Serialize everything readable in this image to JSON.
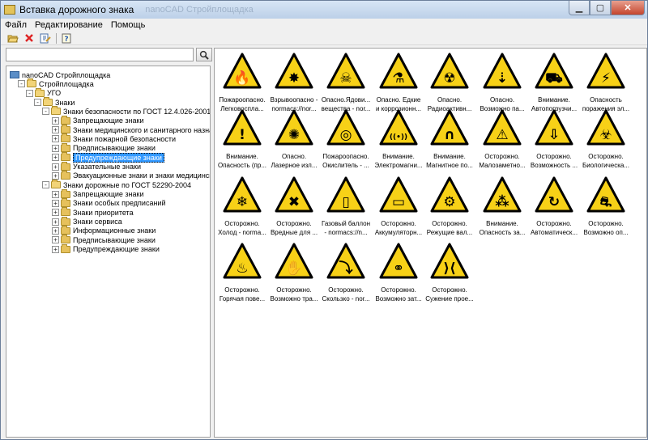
{
  "window": {
    "title": "Вставка дорожного знака",
    "title_ghost": "nanoCAD Стройплощадка",
    "min_icon": "minimize-icon",
    "max_icon": "maximize-icon",
    "close_icon": "close-icon"
  },
  "menu": [
    "Файл",
    "Редактирование",
    "Помощь"
  ],
  "toolbar": {
    "icons": [
      "open-folder-icon",
      "delete-icon",
      "edit-icon",
      "help-icon"
    ]
  },
  "search": {
    "value": "",
    "placeholder": "",
    "icon": "magnifier-icon"
  },
  "tree": [
    {
      "label": "nanoCAD Стройплощадка",
      "level": 0,
      "toggle": "",
      "icon": "root",
      "selected": false
    },
    {
      "label": "Стройплощадка",
      "level": 1,
      "toggle": "−",
      "icon": "folder-open",
      "selected": false
    },
    {
      "label": "УГО",
      "level": 2,
      "toggle": "−",
      "icon": "folder-open",
      "selected": false
    },
    {
      "label": "Знаки",
      "level": 3,
      "toggle": "−",
      "icon": "folder-open",
      "selected": false
    },
    {
      "label": "Знаки безопасности по ГОСТ 12.4.026-2001",
      "level": 4,
      "toggle": "−",
      "icon": "folder-open",
      "selected": false
    },
    {
      "label": "Запрещающие знаки",
      "level": 5,
      "toggle": "+",
      "icon": "folder",
      "selected": false
    },
    {
      "label": "Знаки медицинского и санитарного назначения",
      "level": 5,
      "toggle": "+",
      "icon": "folder",
      "selected": false
    },
    {
      "label": "Знаки пожарной безопасности",
      "level": 5,
      "toggle": "+",
      "icon": "folder",
      "selected": false
    },
    {
      "label": "Предписывающие знаки",
      "level": 5,
      "toggle": "+",
      "icon": "folder",
      "selected": false
    },
    {
      "label": "Предупреждающие знаки",
      "level": 5,
      "toggle": "+",
      "icon": "folder",
      "selected": true
    },
    {
      "label": "Указательные знаки",
      "level": 5,
      "toggle": "+",
      "icon": "folder",
      "selected": false
    },
    {
      "label": "Эвакуационные знаки и знаки медицинского",
      "level": 5,
      "toggle": "+",
      "icon": "folder",
      "selected": false
    },
    {
      "label": "Знаки дорожные по ГОСТ 52290-2004",
      "level": 4,
      "toggle": "−",
      "icon": "folder-open",
      "selected": false
    },
    {
      "label": "Запрещающие знаки",
      "level": 5,
      "toggle": "+",
      "icon": "folder",
      "selected": false
    },
    {
      "label": "Знаки особых предписаний",
      "level": 5,
      "toggle": "+",
      "icon": "folder",
      "selected": false
    },
    {
      "label": "Знаки приоритета",
      "level": 5,
      "toggle": "+",
      "icon": "folder",
      "selected": false
    },
    {
      "label": "Знаки сервиса",
      "level": 5,
      "toggle": "+",
      "icon": "folder",
      "selected": false
    },
    {
      "label": "Информационные знаки",
      "level": 5,
      "toggle": "+",
      "icon": "folder",
      "selected": false
    },
    {
      "label": "Предписывающие знаки",
      "level": 5,
      "toggle": "+",
      "icon": "folder",
      "selected": false
    },
    {
      "label": "Предупреждающие знаки",
      "level": 5,
      "toggle": "+",
      "icon": "folder",
      "selected": false
    }
  ],
  "signs": [
    {
      "line1": "Пожароопасно.",
      "line2": "Легковоспла...",
      "glyph": "🔥",
      "icon": "flammable-icon"
    },
    {
      "line1": "Взрывоопасно -",
      "line2": "normacs://nor...",
      "glyph": "✸",
      "icon": "explosive-icon"
    },
    {
      "line1": "Опасно.Ядови...",
      "line2": "вещества - nor...",
      "glyph": "☠",
      "icon": "toxic-icon"
    },
    {
      "line1": "Опасно. Едкие",
      "line2": "и коррозионн...",
      "glyph": "⚗",
      "icon": "corrosive-icon"
    },
    {
      "line1": "Опасно.",
      "line2": "Радиоактивн...",
      "glyph": "☢",
      "icon": "radioactive-icon"
    },
    {
      "line1": "Опасно.",
      "line2": "Возможно па...",
      "glyph": "⇣",
      "icon": "falling-load-icon"
    },
    {
      "line1": "Внимание.",
      "line2": "Автопогрузчи...",
      "glyph": "⛟",
      "icon": "forklift-icon"
    },
    {
      "line1": "Опасность",
      "line2": "поражения эл...",
      "glyph": "⚡",
      "icon": "electric-shock-icon"
    },
    {
      "line1": "Внимание.",
      "line2": "Опасность (пр...",
      "glyph": "!",
      "icon": "general-danger-icon"
    },
    {
      "line1": "Опасно.",
      "line2": "Лазерное изл...",
      "glyph": "✺",
      "icon": "laser-icon"
    },
    {
      "line1": "Пожароопасно.",
      "line2": "Окислитель - ...",
      "glyph": "◎",
      "icon": "oxidizer-icon"
    },
    {
      "line1": "Внимание.",
      "line2": "Электромагни...",
      "glyph": "((•))",
      "icon": "electromagnetic-icon"
    },
    {
      "line1": "Внимание.",
      "line2": "Магнитное по...",
      "glyph": "∩",
      "icon": "magnetic-field-icon"
    },
    {
      "line1": "Осторожно.",
      "line2": "Малозаметно...",
      "glyph": "⚠",
      "icon": "obstacle-icon"
    },
    {
      "line1": "Осторожно.",
      "line2": "Возможность ...",
      "glyph": "⇩",
      "icon": "fall-from-height-icon"
    },
    {
      "line1": "Осторожно.",
      "line2": "Биологическа...",
      "glyph": "☣",
      "icon": "biohazard-icon"
    },
    {
      "line1": "Осторожно.",
      "line2": "Холод - norma...",
      "glyph": "❄",
      "icon": "cold-icon"
    },
    {
      "line1": "Осторожно.",
      "line2": "Вредные для ...",
      "glyph": "✖",
      "icon": "harmful-icon"
    },
    {
      "line1": "Газовый баллон",
      "line2": "- normacs://n...",
      "glyph": "▯",
      "icon": "gas-cylinder-icon"
    },
    {
      "line1": "Осторожно.",
      "line2": "Аккумуляторн...",
      "glyph": "▭",
      "icon": "battery-icon"
    },
    {
      "line1": "Осторожно.",
      "line2": "Режущие вал...",
      "glyph": "⚙",
      "icon": "cutting-shafts-icon"
    },
    {
      "line1": "Внимание.",
      "line2": "Опасность за...",
      "glyph": "⁂",
      "icon": "entanglement-icon"
    },
    {
      "line1": "Осторожно.",
      "line2": "Автоматическ...",
      "glyph": "↻",
      "icon": "automatic-start-icon"
    },
    {
      "line1": "Осторожно.",
      "line2": "Возможно оп...",
      "glyph": "⛐",
      "icon": "tip-over-icon"
    },
    {
      "line1": "Осторожно.",
      "line2": "Горячая пове...",
      "glyph": "♨",
      "icon": "hot-surface-icon"
    },
    {
      "line1": "Осторожно.",
      "line2": "Возможно тра...",
      "glyph": "✋",
      "icon": "hand-injury-icon"
    },
    {
      "line1": "Осторожно.",
      "line2": "Скользко - nor...",
      "glyph": "⤵",
      "icon": "slippery-icon"
    },
    {
      "line1": "Осторожно.",
      "line2": "Возможно зат...",
      "glyph": "⚭",
      "icon": "pinch-point-icon"
    },
    {
      "line1": "Осторожно.",
      "line2": "Сужение прое...",
      "glyph": "⟩⟨",
      "icon": "narrowing-icon"
    }
  ],
  "colors": {
    "sign_fill": "#f7d117",
    "sign_border": "#000000",
    "selection": "#3399ff"
  }
}
